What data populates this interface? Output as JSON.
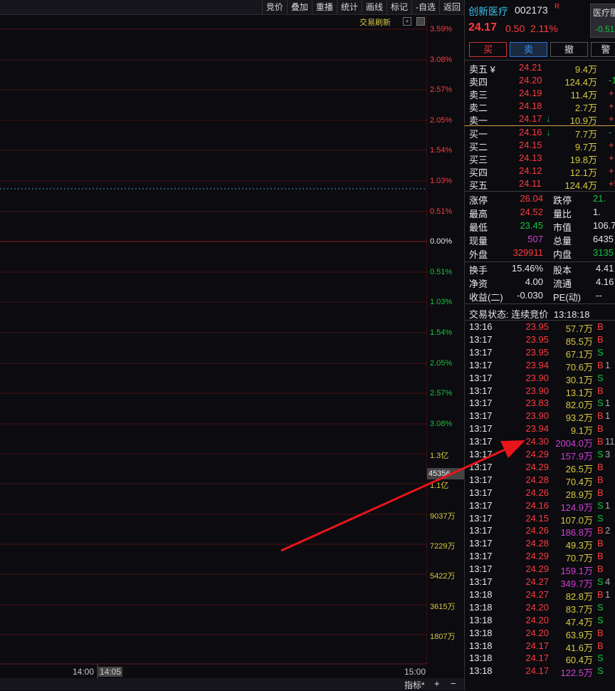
{
  "toolbar": [
    "竞价",
    "叠加",
    "重播",
    "统计",
    "画线",
    "标记",
    "-自选",
    "返回"
  ],
  "refresh_label": "交易刷新",
  "price_labels": [
    {
      "t": "3.59%",
      "c": "red"
    },
    {
      "t": "3.08%",
      "c": "red"
    },
    {
      "t": "2.57%",
      "c": "red"
    },
    {
      "t": "2.05%",
      "c": "red"
    },
    {
      "t": "1.54%",
      "c": "red"
    },
    {
      "t": "1.03%",
      "c": "red"
    },
    {
      "t": "0.51%",
      "c": "red"
    },
    {
      "t": "0.00%",
      "c": "white"
    },
    {
      "t": "0.51%",
      "c": "green"
    },
    {
      "t": "1.03%",
      "c": "green"
    },
    {
      "t": "1.54%",
      "c": "green"
    },
    {
      "t": "2.05%",
      "c": "green"
    },
    {
      "t": "2.57%",
      "c": "green"
    },
    {
      "t": "3.08%",
      "c": "green"
    }
  ],
  "volume_labels": [
    "1.3亿",
    "1.1亿",
    "9037万",
    "7229万",
    "5422万",
    "3615万",
    "1807万"
  ],
  "price_tag": "45356",
  "time_labels": [
    "14:00",
    "14:05",
    "15:00"
  ],
  "bottom": {
    "indicator": "指标*",
    "plus": "+",
    "minus": "−"
  },
  "stock": {
    "name": "创新医疗",
    "code": "002173",
    "flag": "R",
    "price": "24.17",
    "change": "0.50",
    "pct": "2.11%",
    "sector": "医疗服",
    "sector_chg": "-0.51"
  },
  "buttons": [
    "买",
    "卖",
    "撤",
    "警"
  ],
  "asks": [
    {
      "label": "卖五 ¥",
      "price": "24.21",
      "vol": "9.4万",
      "chg": ""
    },
    {
      "label": "卖四",
      "price": "24.20",
      "vol": "124.4万",
      "chg": "-1"
    },
    {
      "label": "卖三",
      "price": "24.19",
      "vol": "11.4万",
      "chg": "+"
    },
    {
      "label": "卖二",
      "price": "24.18",
      "vol": "2.7万",
      "chg": "+"
    },
    {
      "label": "卖一",
      "price": "24.17",
      "vol": "10.9万",
      "chg": "+",
      "arrow": "↓"
    }
  ],
  "bids": [
    {
      "label": "买一",
      "price": "24.16",
      "vol": "7.7万",
      "chg": "-",
      "arrow": "↓"
    },
    {
      "label": "买二",
      "price": "24.15",
      "vol": "9.7万",
      "chg": "+"
    },
    {
      "label": "买三",
      "price": "24.13",
      "vol": "19.8万",
      "chg": "+"
    },
    {
      "label": "买四",
      "price": "24.12",
      "vol": "12.1万",
      "chg": "+"
    },
    {
      "label": "买五",
      "price": "24.11",
      "vol": "124.4万",
      "chg": "+5"
    }
  ],
  "stats": [
    {
      "l1": "涨停",
      "v1": "26.04",
      "c1": "red",
      "l2": "跌停",
      "v2": "21.",
      "c2": "green"
    },
    {
      "l1": "最高",
      "v1": "24.52",
      "c1": "red",
      "l2": "量比",
      "v2": "1.",
      "c2": "white"
    },
    {
      "l1": "最低",
      "v1": "23.45",
      "c1": "green",
      "l2": "市值",
      "v2": "106.7",
      "c2": "white"
    },
    {
      "l1": "现量",
      "v1": "507",
      "c1": "magenta",
      "l2": "总量",
      "v2": "6435",
      "c2": "white"
    },
    {
      "l1": "外盘",
      "v1": "329911",
      "c1": "red",
      "l2": "内盘",
      "v2": "3135",
      "c2": "green"
    }
  ],
  "stats2": [
    {
      "l1": "换手",
      "v1": "15.46%",
      "l2": "股本",
      "v2": "4.41"
    },
    {
      "l1": "净资",
      "v1": "4.00",
      "l2": "流通",
      "v2": "4.16"
    },
    {
      "l1": "收益(二)",
      "v1": "-0.030",
      "l2": "PE(动)",
      "v2": "--"
    }
  ],
  "status": {
    "label": "交易状态: 连续竞价",
    "time": "13:18:18"
  },
  "ticks": [
    {
      "t": "13:16",
      "p": "23.95",
      "v": "57.7万",
      "vc": "yellow",
      "s": "B",
      "x": ""
    },
    {
      "t": "13:17",
      "p": "23.95",
      "v": "85.5万",
      "vc": "yellow",
      "s": "B",
      "x": ""
    },
    {
      "t": "13:17",
      "p": "23.95",
      "v": "67.1万",
      "vc": "yellow",
      "s": "S",
      "x": ""
    },
    {
      "t": "13:17",
      "p": "23.94",
      "v": "70.6万",
      "vc": "yellow",
      "s": "B",
      "x": "1"
    },
    {
      "t": "13:17",
      "p": "23.90",
      "v": "30.1万",
      "vc": "yellow",
      "s": "S",
      "x": ""
    },
    {
      "t": "13:17",
      "p": "23.90",
      "v": "13.1万",
      "vc": "yellow",
      "s": "B",
      "x": ""
    },
    {
      "t": "13:17",
      "p": "23.83",
      "v": "82.0万",
      "vc": "yellow",
      "s": "S",
      "x": "1"
    },
    {
      "t": "13:17",
      "p": "23.90",
      "v": "93.2万",
      "vc": "yellow",
      "s": "B",
      "x": "1"
    },
    {
      "t": "13:17",
      "p": "23.94",
      "v": "9.1万",
      "vc": "yellow",
      "s": "B",
      "x": ""
    },
    {
      "t": "13:17",
      "p": "24.30",
      "v": "2004.0万",
      "vc": "magenta",
      "s": "B",
      "x": "11"
    },
    {
      "t": "13:17",
      "p": "24.29",
      "v": "157.9万",
      "vc": "magenta",
      "s": "S",
      "x": "3"
    },
    {
      "t": "13:17",
      "p": "24.29",
      "v": "26.5万",
      "vc": "yellow",
      "s": "B",
      "x": ""
    },
    {
      "t": "13:17",
      "p": "24.28",
      "v": "70.4万",
      "vc": "yellow",
      "s": "B",
      "x": ""
    },
    {
      "t": "13:17",
      "p": "24.26",
      "v": "28.9万",
      "vc": "yellow",
      "s": "B",
      "x": ""
    },
    {
      "t": "13:17",
      "p": "24.16",
      "v": "124.9万",
      "vc": "magenta",
      "s": "S",
      "x": "1"
    },
    {
      "t": "13:17",
      "p": "24.15",
      "v": "107.0万",
      "vc": "yellow",
      "s": "S",
      "x": ""
    },
    {
      "t": "13:17",
      "p": "24.26",
      "v": "186.8万",
      "vc": "magenta",
      "s": "B",
      "x": "2"
    },
    {
      "t": "13:17",
      "p": "24.28",
      "v": "49.3万",
      "vc": "yellow",
      "s": "B",
      "x": ""
    },
    {
      "t": "13:17",
      "p": "24.29",
      "v": "70.7万",
      "vc": "yellow",
      "s": "B",
      "x": ""
    },
    {
      "t": "13:17",
      "p": "24.29",
      "v": "159.1万",
      "vc": "magenta",
      "s": "B",
      "x": ""
    },
    {
      "t": "13:17",
      "p": "24.27",
      "v": "349.7万",
      "vc": "magenta",
      "s": "S",
      "x": "4"
    },
    {
      "t": "13:18",
      "p": "24.27",
      "v": "82.8万",
      "vc": "yellow",
      "s": "B",
      "x": "1"
    },
    {
      "t": "13:18",
      "p": "24.20",
      "v": "83.7万",
      "vc": "yellow",
      "s": "S",
      "x": ""
    },
    {
      "t": "13:18",
      "p": "24.20",
      "v": "47.4万",
      "vc": "yellow",
      "s": "S",
      "x": ""
    },
    {
      "t": "13:18",
      "p": "24.20",
      "v": "63.9万",
      "vc": "yellow",
      "s": "B",
      "x": ""
    },
    {
      "t": "13:18",
      "p": "24.17",
      "v": "41.6万",
      "vc": "yellow",
      "s": "B",
      "x": ""
    },
    {
      "t": "13:18",
      "p": "24.17",
      "v": "60.4万",
      "vc": "yellow",
      "s": "S",
      "x": ""
    },
    {
      "t": "13:18",
      "p": "24.17",
      "v": "122.5万",
      "vc": "magenta",
      "s": "S",
      "x": ""
    }
  ]
}
